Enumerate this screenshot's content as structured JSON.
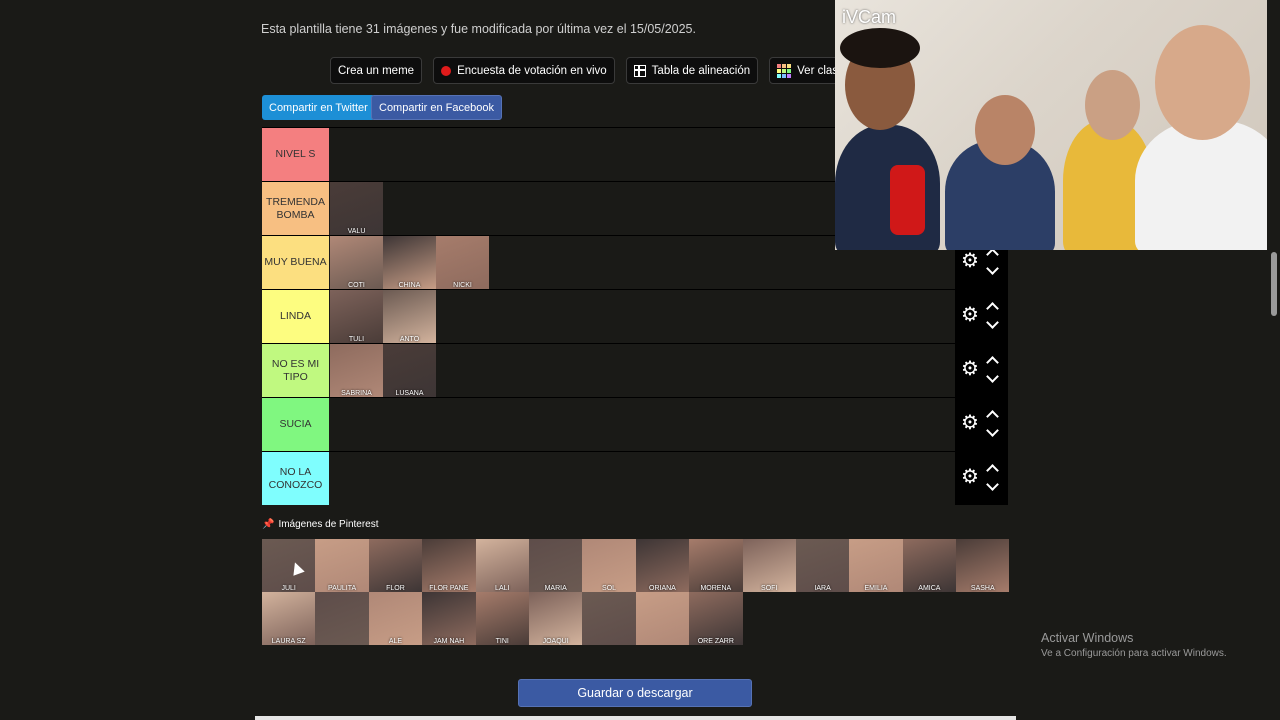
{
  "info_text": "Esta plantilla tiene 31 imágenes y fue modificada por última vez el 15/05/2025.",
  "actions": {
    "meme": "Crea un meme",
    "poll": "Encuesta de votación en vivo",
    "alignment": "Tabla de alineación",
    "ranking": "Ver clasificac"
  },
  "share": {
    "twitter": "Compartir en Twitter",
    "facebook": "Compartir en Facebook"
  },
  "tiers": [
    {
      "label": "NIVEL S",
      "color": "#f47f80",
      "items": []
    },
    {
      "label": "TREMENDA BOMBA",
      "color": "#f7bf82",
      "items": [
        "VALU"
      ]
    },
    {
      "label": "MUY BUENA",
      "color": "#fcdf80",
      "items": [
        "COTI",
        "CHINA",
        "NICKI"
      ]
    },
    {
      "label": "LINDA",
      "color": "#fdfd80",
      "items": [
        "TULI",
        "ANTO"
      ]
    },
    {
      "label": "NO ES MI TIPO",
      "color": "#c0f980",
      "items": [
        "SABRINA",
        "LUSANA"
      ]
    },
    {
      "label": "SUCIA",
      "color": "#80f780",
      "items": []
    },
    {
      "label": "NO LA CONOZCO",
      "color": "#7ffefe",
      "items": []
    }
  ],
  "pinterest_title": "Imágenes de Pinterest",
  "pool": [
    "JULI",
    "PAULITA",
    "FLOR",
    "FLOR PANE",
    "LALI",
    "MARIA",
    "SOL",
    "ORIANA",
    "MORENA",
    "SOFI",
    "IARA",
    "EMILIA",
    "AMICA",
    "SASHA",
    "LAURA SZ",
    "",
    "ALE",
    "JAM NAH",
    "TINI",
    "JOAQUI",
    "",
    "",
    "ORE ZARR"
  ],
  "save_button": "Guardar o descargar",
  "camera_label": "iVCam",
  "watermark": {
    "title": "Activar Windows",
    "subtitle": "Ve a Configuración para activar Windows."
  }
}
